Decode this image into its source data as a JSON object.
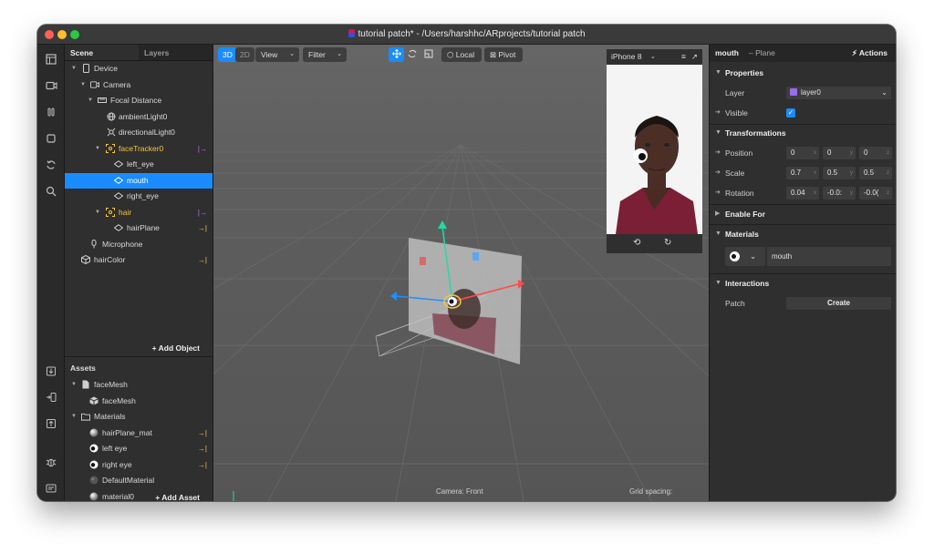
{
  "window": {
    "title": "tutorial patch* - /Users/harshhc/ARprojects/tutorial patch"
  },
  "colors": {
    "accent": "#1a8cff",
    "yellow": "#f5c542",
    "purple": "#c06cff"
  },
  "scene_panel": {
    "tabs": [
      "Scene",
      "Layers"
    ],
    "tree": [
      {
        "label": "Device",
        "icon": "phone-icon"
      },
      {
        "label": "Camera",
        "icon": "camera-icon"
      },
      {
        "label": "Focal Distance",
        "icon": "ruler-icon"
      },
      {
        "label": "ambientLight0",
        "icon": "globe-light-icon"
      },
      {
        "label": "directionalLight0",
        "icon": "sun-icon"
      },
      {
        "label": "faceTracker0",
        "icon": "face-tracker-icon",
        "badge": "|→"
      },
      {
        "label": "left_eye",
        "icon": "plane-icon"
      },
      {
        "label": "mouth",
        "icon": "plane-icon"
      },
      {
        "label": "right_eye",
        "icon": "plane-icon"
      },
      {
        "label": "hair",
        "icon": "face-tracker-icon",
        "badge": "|→"
      },
      {
        "label": "hairPlane",
        "icon": "plane-icon",
        "badge": "→|"
      },
      {
        "label": "Microphone",
        "icon": "microphone-icon"
      },
      {
        "label": "hairColor",
        "icon": "cube-icon",
        "badge": "→|"
      }
    ],
    "add_object": "Add Object"
  },
  "assets_panel": {
    "title": "Assets",
    "items": [
      {
        "label": "faceMesh",
        "icon": "file-icon"
      },
      {
        "label": "faceMesh",
        "icon": "mesh-icon"
      },
      {
        "label": "Materials",
        "icon": "folder-icon"
      },
      {
        "label": "hairPlane_mat",
        "icon": "material-sphere-icon",
        "badge": "→|"
      },
      {
        "label": "left eye",
        "icon": "eye-material-icon",
        "badge": "→|"
      },
      {
        "label": "right eye",
        "icon": "eye-material-icon",
        "badge": "→|"
      },
      {
        "label": "DefaultMaterial",
        "icon": "material-sphere-icon"
      },
      {
        "label": "material0",
        "icon": "material-sphere-icon"
      }
    ],
    "add_asset": "Add Asset"
  },
  "viewport": {
    "mode_3d": "3D",
    "mode_2d": "2D",
    "view": "View",
    "filter": "Filter",
    "local": "Local",
    "pivot": "Pivot",
    "device": "iPhone 8",
    "camera_label": "Camera: Front",
    "grid_label": "Grid spacing:"
  },
  "inspector": {
    "object_name": "mouth",
    "object_type": "– Plane",
    "actions": "Actions",
    "properties": "Properties",
    "layer_label": "Layer",
    "layer_value": "layer0",
    "visible_label": "Visible",
    "transformations": "Transformations",
    "position_label": "Position",
    "position": [
      "0",
      "0",
      "0"
    ],
    "scale_label": "Scale",
    "scale": [
      "0.7",
      "0.5",
      "0.5"
    ],
    "rotation_label": "Rotation",
    "rotation": [
      "0.04",
      "-0.0:",
      "-0.0("
    ],
    "axes": [
      "x",
      "y",
      "z"
    ],
    "enable_for": "Enable For",
    "materials": "Materials",
    "material_value": "mouth",
    "interactions": "Interactions",
    "patch_label": "Patch",
    "create": "Create"
  }
}
